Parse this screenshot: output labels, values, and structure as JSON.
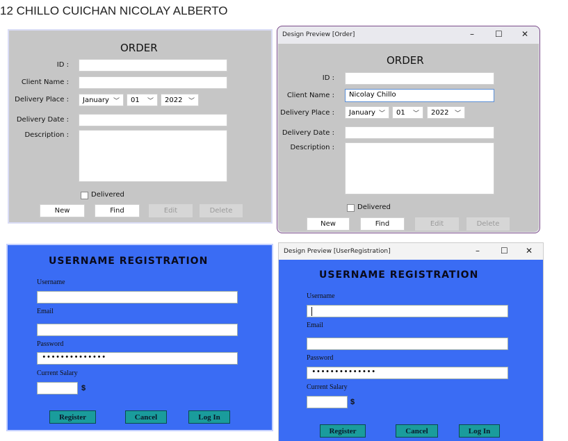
{
  "header": {
    "text": "12     CHILLO CUICHAN NICOLAY ALBERTO"
  },
  "order": {
    "title": "ORDER",
    "labels": {
      "id": "ID :",
      "client_name": "Client Name :",
      "delivery_place": "Delivery Place :",
      "delivery_date": "Delivery Date :",
      "description": "Description :"
    },
    "month": "January",
    "day": "01",
    "year": "2022",
    "delivered_label": "Delivered",
    "buttons": {
      "new": "New",
      "find": "Find",
      "edit": "Edit",
      "delete": "Delete"
    },
    "preview": {
      "window_title": "Design Preview [Order]",
      "client_name_value": "Nicolay Chillo"
    }
  },
  "registration": {
    "title": "USERNAME REGISTRATION",
    "labels": {
      "username": "Username",
      "email": "Email",
      "password": "Password",
      "salary": "Current Salary"
    },
    "password_mask": "••••••••••••••",
    "currency": "$",
    "buttons": {
      "register": "Register",
      "cancel": "Cancel",
      "login": "Log In"
    },
    "preview": {
      "window_title": "Design Preview [UserRegistration]"
    }
  },
  "window_controls": {
    "minimize": "–",
    "maximize": "☐",
    "close": "✕"
  },
  "colors": {
    "order_bg": "#c6c6c6",
    "reg_bg": "#3a6cf4",
    "reg_button": "#1a9c9c"
  }
}
